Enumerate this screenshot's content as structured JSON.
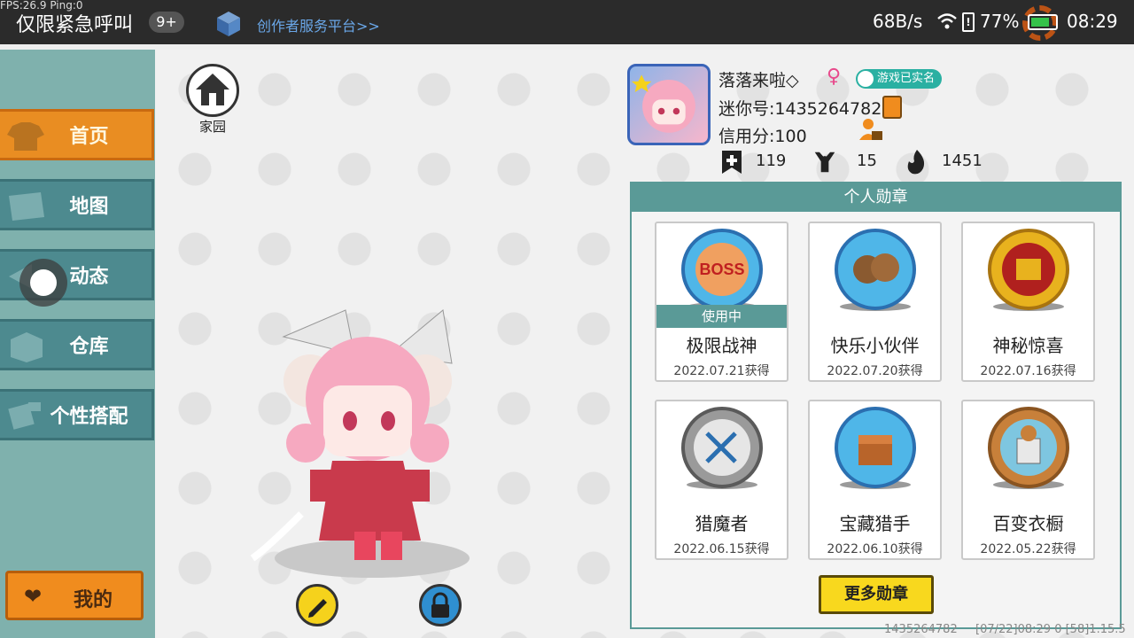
{
  "statusbar": {
    "debug": "FPS:26.9  Ping:0",
    "title": "仅限紧急呼叫",
    "badge": "9+",
    "creator_link": "创作者服务平台>>",
    "net_speed": "68B/s",
    "battery_pct": "77%",
    "battery_level": 0.77,
    "time": "08:29",
    "icons": [
      "cube-icon",
      "wifi-icon",
      "battery-alert-icon",
      "battery-icon",
      "gear-icon"
    ]
  },
  "sidebar": {
    "items": [
      {
        "label": "首页",
        "icon": "shirt-icon",
        "active": true
      },
      {
        "label": "地图",
        "icon": "map-icon",
        "active": false
      },
      {
        "label": "动态",
        "icon": "feed-icon",
        "active": false
      },
      {
        "label": "仓库",
        "icon": "box-icon",
        "active": false
      },
      {
        "label": "个性搭配",
        "icon": "outfit-icon",
        "active": false
      }
    ],
    "mine_label": "我的",
    "mine_icon": "heart-icon"
  },
  "home": {
    "label": "家园",
    "icon": "house-icon"
  },
  "profile": {
    "nickname": "落落来啦",
    "nickname_mark": "◇",
    "gender": "♀",
    "verified": "游戏已实名",
    "mini_id": "迷你号:1435264782",
    "credit": "信用分:100",
    "stats": [
      {
        "icon": "bookmark-plus-icon",
        "value": "119"
      },
      {
        "icon": "cheer-icon",
        "value": "15"
      },
      {
        "icon": "flame-icon",
        "value": "1451"
      }
    ]
  },
  "medals": {
    "title": "个人勋章",
    "in_use_label": "使用中",
    "items": [
      {
        "name": "极限战神",
        "date": "2022.07.21获得",
        "in_use": true,
        "icon": "boss-medal-icon",
        "color": "#4fb6e8"
      },
      {
        "name": "快乐小伙伴",
        "date": "2022.07.20获得",
        "in_use": false,
        "icon": "friends-medal-icon",
        "color": "#4fb6e8"
      },
      {
        "name": "神秘惊喜",
        "date": "2022.07.16获得",
        "in_use": false,
        "icon": "gift-medal-icon",
        "color": "#e8b21e"
      },
      {
        "name": "猎魔者",
        "date": "2022.06.15获得",
        "in_use": false,
        "icon": "sword-medal-icon",
        "color": "#9a9a9a"
      },
      {
        "name": "宝藏猎手",
        "date": "2022.06.10获得",
        "in_use": false,
        "icon": "treasure-medal-icon",
        "color": "#4fb6e8"
      },
      {
        "name": "百变衣橱",
        "date": "2022.05.22获得",
        "in_use": false,
        "icon": "wardrobe-medal-icon",
        "color": "#c8803a"
      }
    ],
    "more_label": "更多勋章"
  },
  "footer": {
    "id": "1435264782",
    "timestamp": "[07/22]08:29 0  [58]1.15.5"
  },
  "colors": {
    "accent_orange": "#e98d22",
    "teal": "#5a9a97",
    "sidebar_bg": "#7fb1ad",
    "button_yellow": "#f8d81e"
  }
}
